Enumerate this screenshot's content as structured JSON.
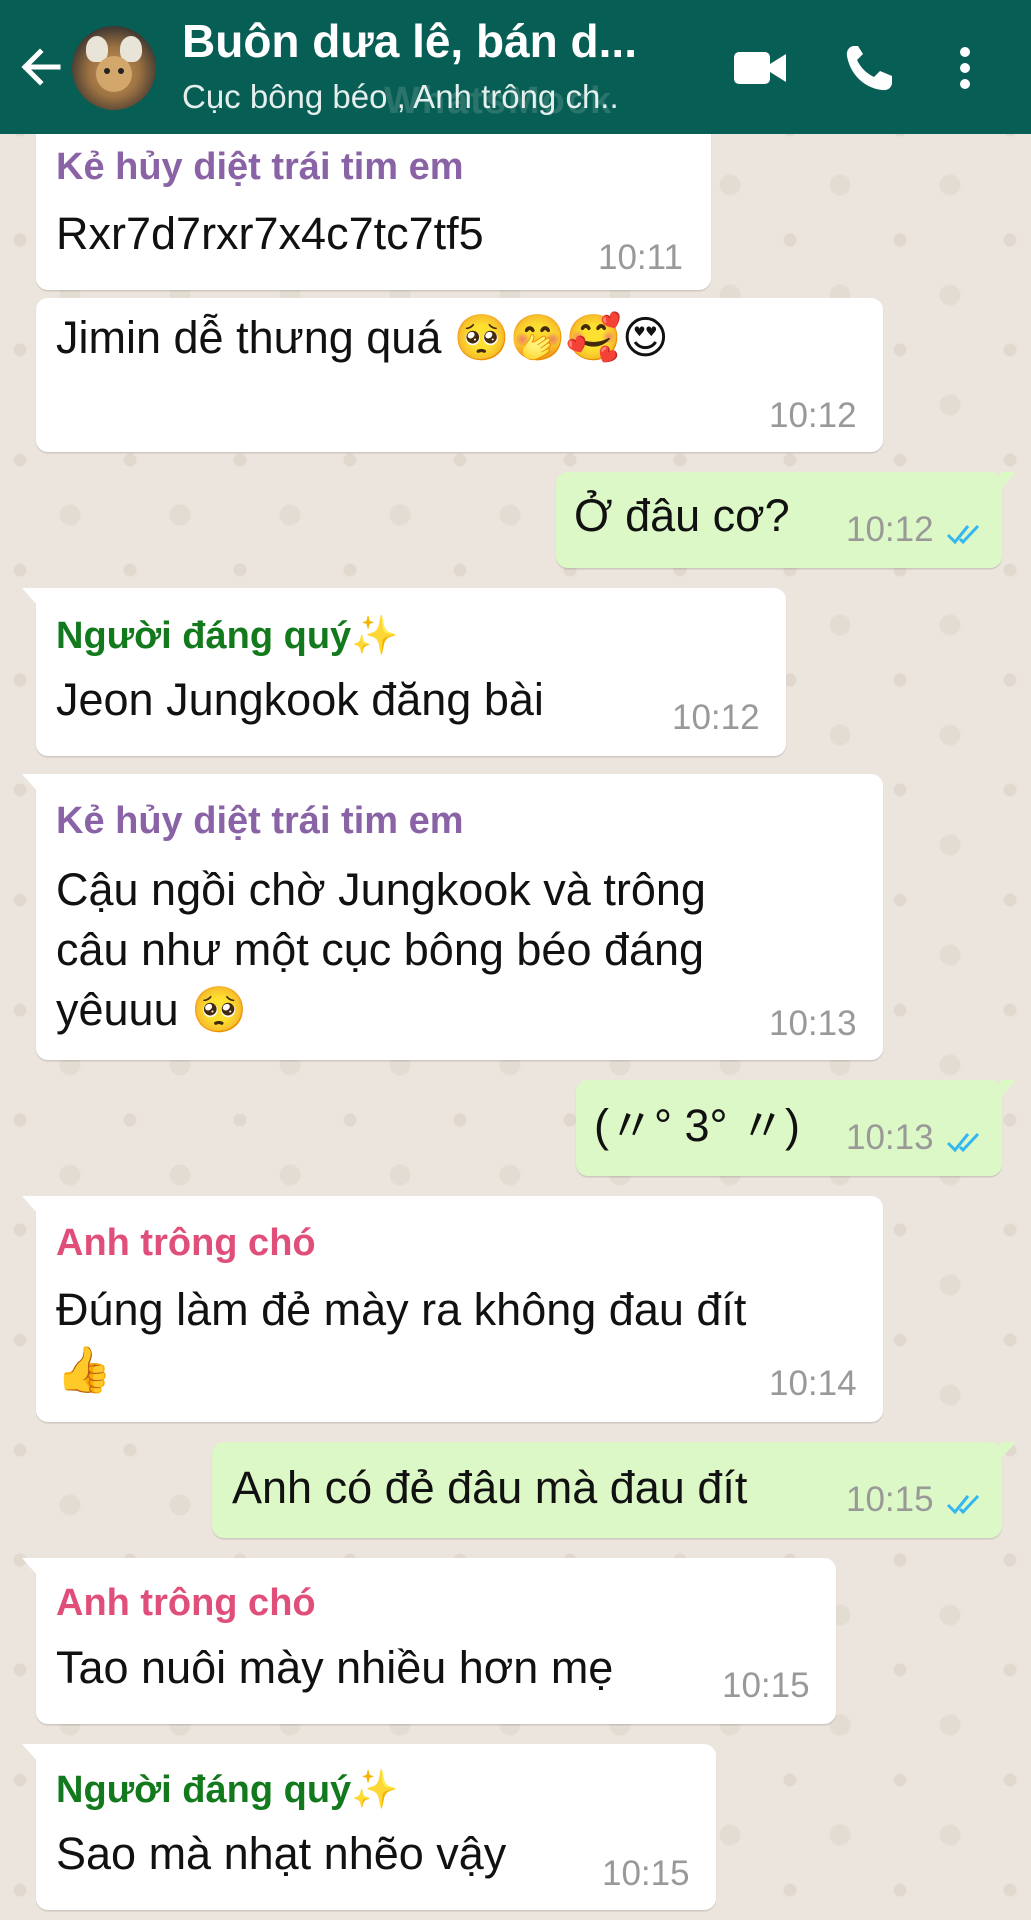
{
  "header": {
    "title": "Buôn dưa lê, bán d...",
    "subtitle": "Cục bông béo , Anh trông ch..",
    "watermark": "WhatsMock",
    "background": "#075e54"
  },
  "colors": {
    "sender_purple": "#8a63a6",
    "sender_green": "#127a1c",
    "sender_pink": "#e04f7a",
    "incoming_bubble": "#ffffff",
    "outgoing_bubble": "#dcf8c6",
    "read_tick": "#34b7f1"
  },
  "messages": [
    {
      "direction": "in",
      "sender": "Kẻ hủy diệt trái tim em",
      "text": "Rxr7d7rxr7x4c7tc7tf5",
      "time": "10:11"
    },
    {
      "direction": "in",
      "sender": "",
      "text": "Jimin dễ thưng quá 🥺🤭🥰😍",
      "time": "10:12"
    },
    {
      "direction": "out",
      "text": "Ở đâu cơ?",
      "time": "10:12",
      "status": "read"
    },
    {
      "direction": "in",
      "sender": "Người đáng quý✨",
      "text": "Jeon Jungkook đăng bài",
      "time": "10:12"
    },
    {
      "direction": "in",
      "sender": "Kẻ hủy diệt trái tim em",
      "text_lines": [
        "Cậu ngồi chờ Jungkook và trông",
        "câu như một cục bông béo đáng",
        "yêuuu 🥺"
      ],
      "time": "10:13"
    },
    {
      "direction": "out",
      "text": "(〃° 3° 〃)",
      "time": "10:13",
      "status": "read"
    },
    {
      "direction": "in",
      "sender": "Anh trông chó",
      "text_lines": [
        "Đúng làm đẻ mày ra không đau đít",
        "👍"
      ],
      "time": "10:14"
    },
    {
      "direction": "out",
      "text": "Anh có đẻ đâu mà đau đít",
      "time": "10:15",
      "status": "read"
    },
    {
      "direction": "in",
      "sender": "Anh trông chó",
      "text": "Tao nuôi mày nhiều hơn mẹ",
      "time": "10:15"
    },
    {
      "direction": "in",
      "sender": "Người đáng quý✨",
      "text": "Sao mà nhạt nhẽo vậy",
      "time": "10:15"
    }
  ]
}
